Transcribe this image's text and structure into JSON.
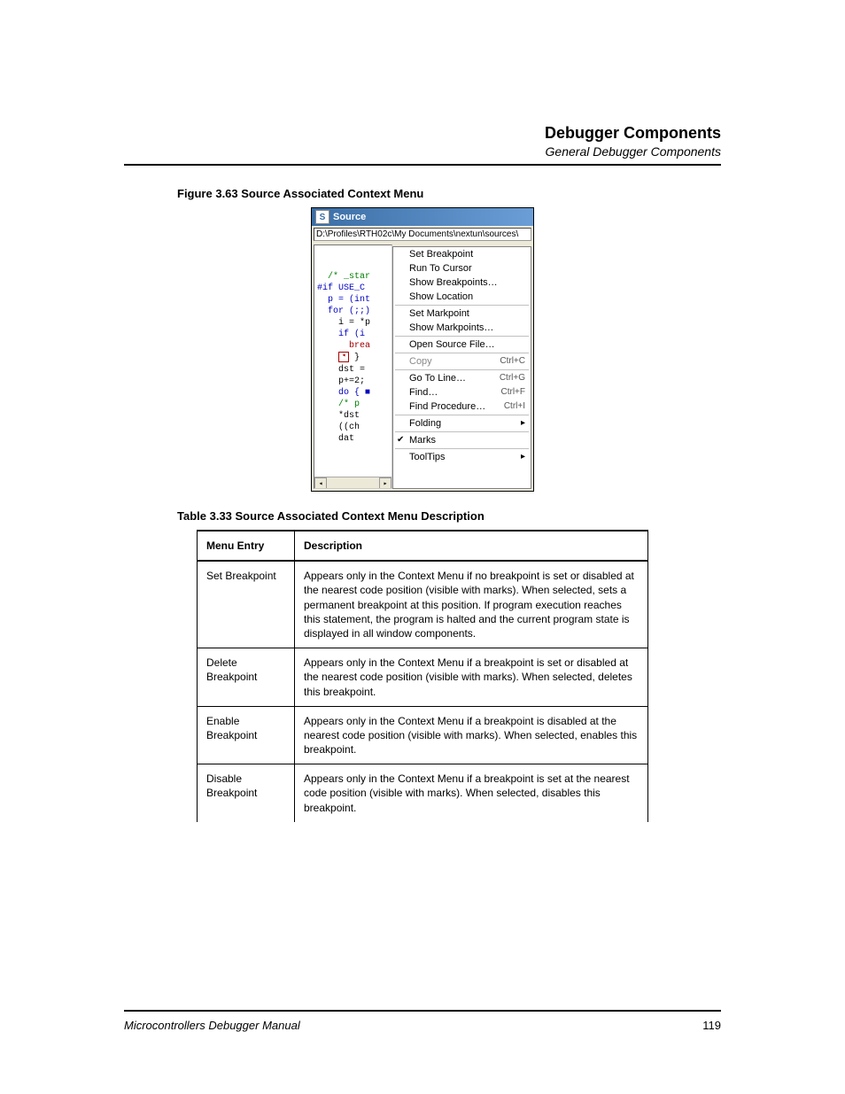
{
  "header": {
    "title": "Debugger Components",
    "subtitle": "General Debugger Components"
  },
  "figure_caption": "Figure 3.63  Source Associated Context Menu",
  "screenshot": {
    "window_title": "Source",
    "path": "D:\\Profiles\\RTH02c\\My Documents\\nextun\\sources\\",
    "code_lines": [
      {
        "t": "  /* _star",
        "c": "green"
      },
      {
        "t": "#if USE_C",
        "c": "blue"
      },
      {
        "t": "  p = (int",
        "c": "blue"
      },
      {
        "t": "  for (;;)",
        "c": "blue"
      },
      {
        "t": "    i = *p",
        "c": "black"
      },
      {
        "t": "    if (i",
        "c": "blue"
      },
      {
        "t": "      brea",
        "c": "red"
      },
      {
        "t": "    ",
        "c": "black",
        "bp": true,
        "after": " }"
      },
      {
        "t": "    dst =",
        "c": "black"
      },
      {
        "t": "    p+=2;",
        "c": "black"
      },
      {
        "t": "    do { ■",
        "c": "blue"
      },
      {
        "t": "    /* p",
        "c": "green"
      },
      {
        "t": "    *dst",
        "c": "black"
      },
      {
        "t": "    ((ch",
        "c": "black"
      },
      {
        "t": "    dat",
        "c": "black"
      }
    ],
    "menu_groups": [
      [
        {
          "label": "Set Breakpoint"
        },
        {
          "label": "Run To Cursor"
        },
        {
          "label": "Show Breakpoints…"
        },
        {
          "label": "Show Location"
        }
      ],
      [
        {
          "label": "Set Markpoint"
        },
        {
          "label": "Show Markpoints…"
        }
      ],
      [
        {
          "label": "Open Source File…"
        }
      ],
      [
        {
          "label": "Copy",
          "shortcut": "Ctrl+C",
          "disabled": true
        }
      ],
      [
        {
          "label": "Go To Line…",
          "shortcut": "Ctrl+G"
        },
        {
          "label": "Find…",
          "shortcut": "Ctrl+F"
        },
        {
          "label": "Find Procedure…",
          "shortcut": "Ctrl+I"
        }
      ],
      [
        {
          "label": "Folding",
          "sub": true
        }
      ],
      [
        {
          "label": "Marks",
          "checked": true
        }
      ],
      [
        {
          "label": "ToolTips",
          "sub": true
        }
      ]
    ]
  },
  "table_caption": "Table 3.33  Source Associated Context Menu Description",
  "table": {
    "headers": [
      "Menu Entry",
      "Description"
    ],
    "rows": [
      {
        "entry": "Set Breakpoint",
        "desc": "Appears only in the Context Menu if no breakpoint is set or disabled at the nearest code position (visible with marks). When selected, sets a permanent breakpoint at this position. If program execution reaches this statement, the program is halted and the current program state is displayed in all window components."
      },
      {
        "entry": "Delete Breakpoint",
        "desc": "Appears only in the Context Menu if a breakpoint is set or disabled at the nearest code position (visible with marks). When selected, deletes this breakpoint."
      },
      {
        "entry": "Enable Breakpoint",
        "desc": "Appears only in the Context Menu if a breakpoint is disabled at the nearest code position (visible with marks). When selected, enables this breakpoint."
      },
      {
        "entry": "Disable Breakpoint",
        "desc": "Appears only in the Context Menu if a breakpoint is set at the nearest code position (visible with marks). When selected, disables this breakpoint."
      }
    ]
  },
  "footer": {
    "left": "Microcontrollers Debugger Manual",
    "right": "119"
  }
}
